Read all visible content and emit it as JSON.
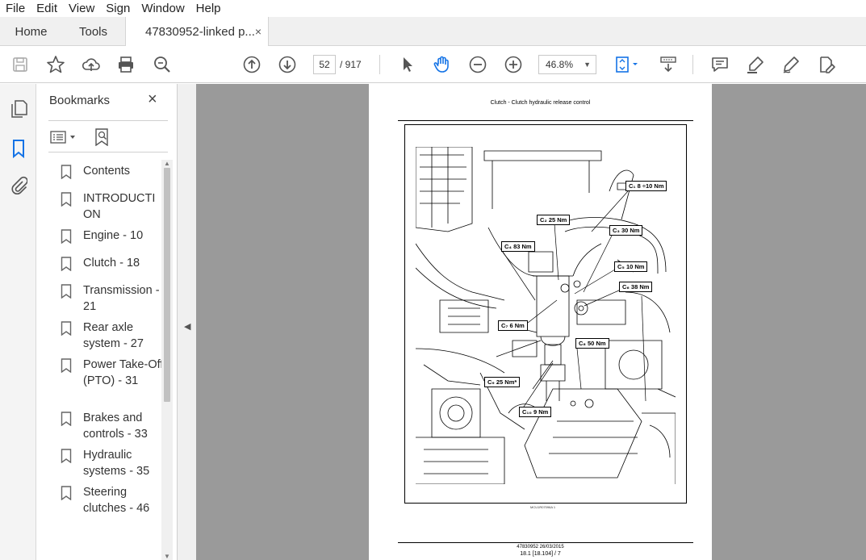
{
  "menu": [
    "File",
    "Edit",
    "View",
    "Sign",
    "Window",
    "Help"
  ],
  "tabs": {
    "home": "Home",
    "tools": "Tools",
    "document": "47830952-linked p...",
    "close_glyph": "×"
  },
  "toolbar": {
    "page_current": "52",
    "page_total": "/ 917",
    "zoom": "46.8%",
    "zoom_caret": "▼"
  },
  "bookmarks": {
    "title": "Bookmarks",
    "close_glyph": "×",
    "items": [
      {
        "label": "Contents"
      },
      {
        "label": "INTRODUCTI ON"
      },
      {
        "label": "Engine - 10"
      },
      {
        "label": "Clutch - 18"
      },
      {
        "label": "Transmission - 21"
      },
      {
        "label": "Rear axle system - 27"
      },
      {
        "label": "Power Take-Off (PTO) - 31"
      },
      {
        "label": "Brakes and controls - 33"
      },
      {
        "label": "Hydraulic systems - 35"
      },
      {
        "label": "Steering clutches - 46"
      }
    ]
  },
  "collapse_arrow": "◀",
  "document": {
    "header": "Clutch - Clutch hydraulic release control",
    "figure_code": "MCU1R07096A 1",
    "footer_line1": "47830952 26/03/2015",
    "footer_line2": "18.1 [18.104] / 7",
    "callouts": [
      {
        "label": "C₁  8 ÷10 Nm"
      },
      {
        "label": "C₂  25 Nm"
      },
      {
        "label": "C₃  30 Nm"
      },
      {
        "label": "C₄  83 Nm"
      },
      {
        "label": "C₅  10 Nm"
      },
      {
        "label": "C₆  38 Nm"
      },
      {
        "label": "C₇  6 Nm"
      },
      {
        "label": "C₈  50 Nm"
      },
      {
        "label": "C₉  25 Nm*"
      },
      {
        "label": "C₁₀  9 Nm"
      }
    ]
  },
  "colors": {
    "accent": "#1473e6",
    "doc_background": "#9a9a9a",
    "toolbar_icon": "#555555"
  },
  "icons": [
    "save-icon",
    "star-icon",
    "upload-icon",
    "print-icon",
    "zoom-search-icon",
    "page-up-icon",
    "page-down-icon",
    "select-arrow-icon",
    "hand-icon",
    "zoom-out-icon",
    "zoom-in-icon",
    "fit-page-icon",
    "scroll-mode-icon",
    "comment-icon",
    "highlight-icon",
    "sign-icon",
    "edit-pdf-icon",
    "pages-icon",
    "bookmark-icon",
    "attachment-icon"
  ]
}
